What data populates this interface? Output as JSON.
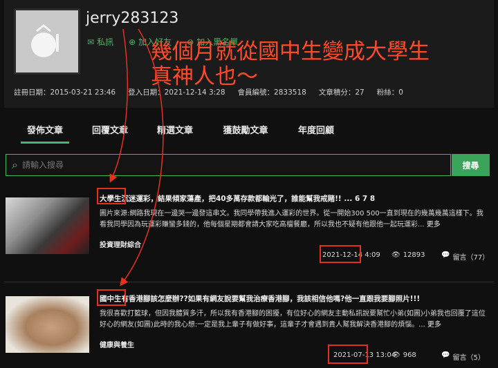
{
  "profile": {
    "username": "jerry283123",
    "actions": {
      "message": "私訊",
      "add_friend": "加入好友",
      "blacklist": "加入黑名單"
    },
    "stats": {
      "register": "註冊日期：2015-03-21 23:46",
      "login": "登入日期：2021-12-14 3:28",
      "member_no": "會員編號：2833518",
      "points": "文章積分：27",
      "fans": "粉絲：0"
    }
  },
  "annotation": {
    "line1": "幾個月就從國中生變成大學生",
    "line2": "真神人也～"
  },
  "tabs": [
    "發佈文章",
    "回覆文章",
    "精選文章",
    "獲鼓勵文章",
    "年度回顧"
  ],
  "search": {
    "placeholder": "請輸入搜尋",
    "button": "搜尋"
  },
  "posts": [
    {
      "title": "大學生沉迷運彩，結果傾家蕩產，把40多萬存款都輸光了，誰能幫我戒賭!!  ...  6  7  8",
      "body": "圖片來源:網路我現在一邊哭一邊發這串文。我同學帶我進入運彩的世界。從一開始300 500一直到現在的幾萬幾萬這樣下。我看我同學因為玩運彩賺蠻多錢的，他每個星期都會請大家吃高檔餐廳，所以我也不疑有他跟他一起玩運彩...",
      "more": "更多",
      "category": "投資理財綜合",
      "date": "2021-12-14 4:09",
      "views": "12893",
      "comments": "留言（77）"
    },
    {
      "title": "國中生有香港腳該怎麼辦??如果有網友說要幫我治療香港腳，我該相信他嗎?他一直跟我要腳照片!!!",
      "body": "我很喜歡打籃球，但因我體質多汗，所以我有香港腳的困擾，有位好心的網友主動私訊說要幫忙小弟(如圖)小弟我也回覆了這位好心的網友(如圖)此時的我心想:一定是我上輩子有做好事，這輩子才會遇到貴人幫我解決香港腳的煩惱。...",
      "more": "更多",
      "category": "健康與養生",
      "date": "2021-07-13 13:04",
      "views": "968",
      "comments": "留言（5）"
    }
  ],
  "colors": {
    "accent": "#48b868",
    "annotation": "#ff4a2a",
    "bg": "#101010"
  }
}
